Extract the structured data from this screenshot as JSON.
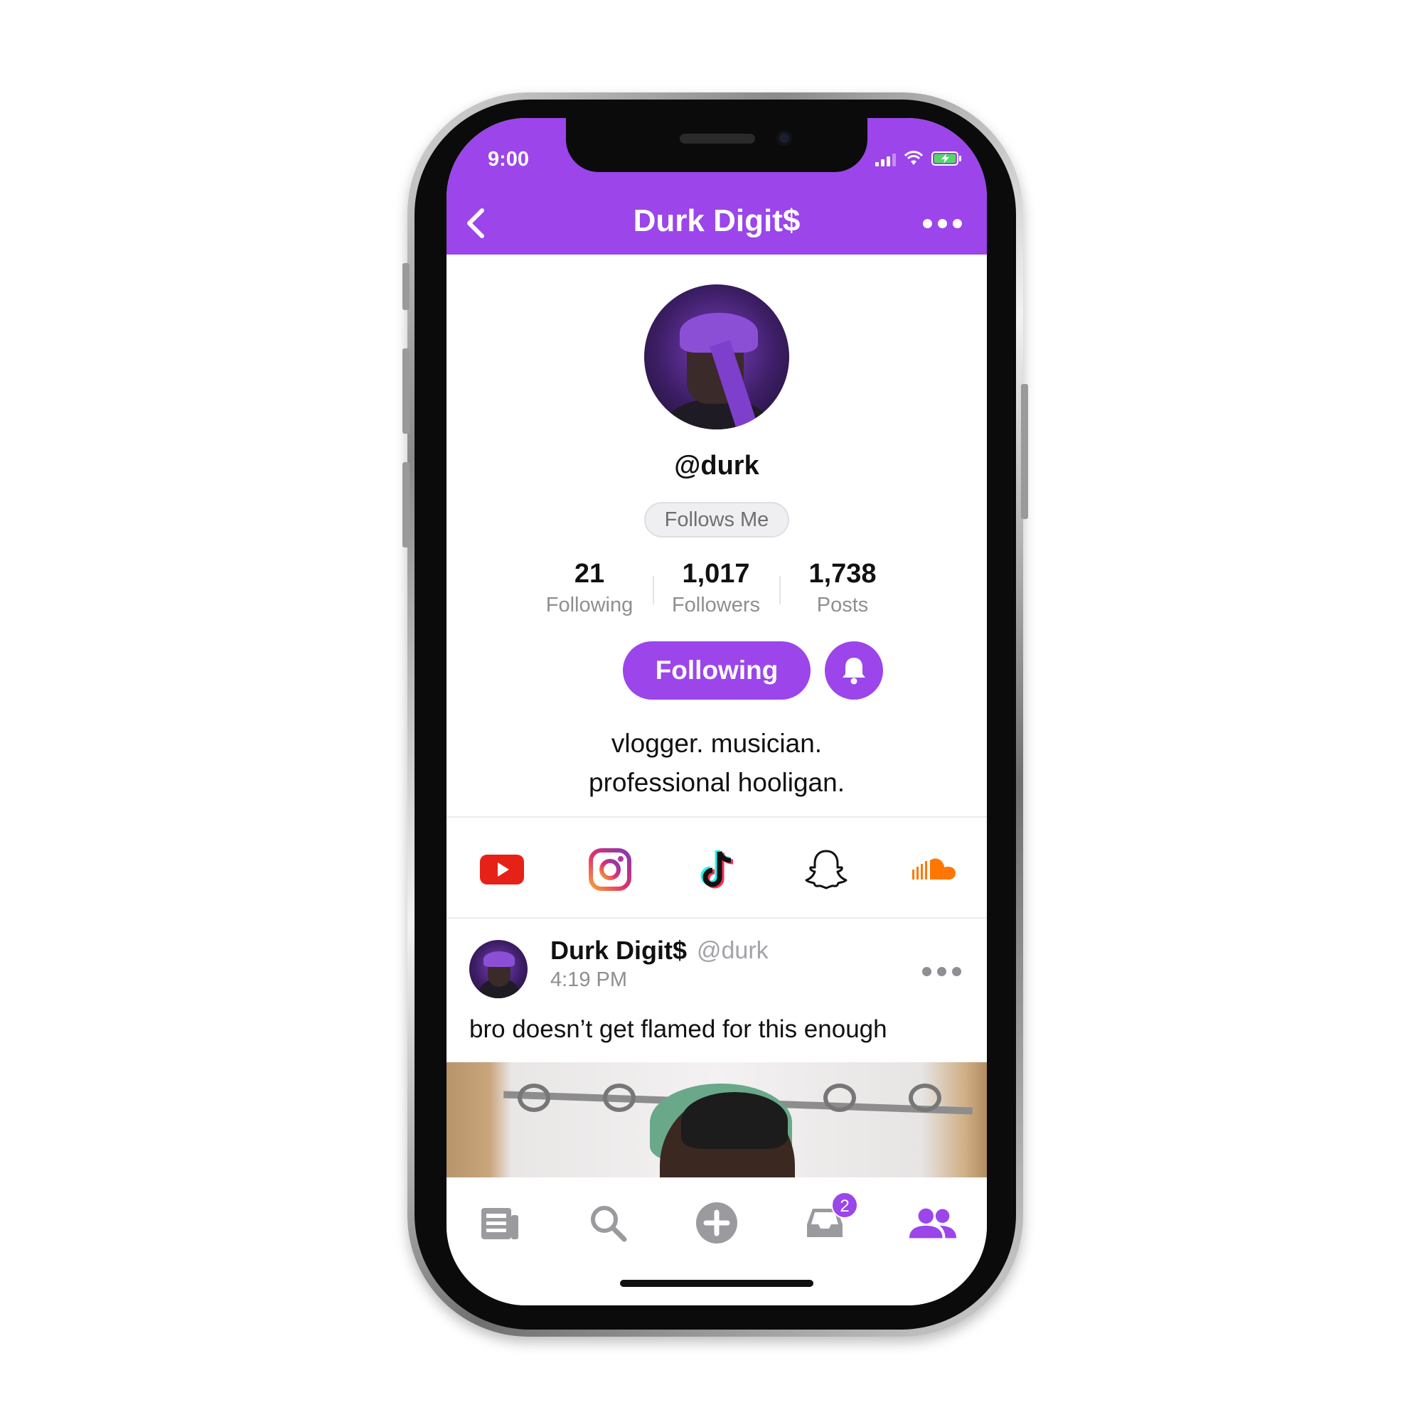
{
  "status_bar": {
    "time": "9:00"
  },
  "header": {
    "title": "Durk Digit$"
  },
  "profile": {
    "handle": "@durk",
    "follows_me_badge": "Follows Me",
    "stats": [
      {
        "value": "21",
        "label": "Following"
      },
      {
        "value": "1,017",
        "label": "Followers"
      },
      {
        "value": "1,738",
        "label": "Posts"
      }
    ],
    "follow_button_label": "Following",
    "bio_line1": "vlogger. musician.",
    "bio_line2": "professional hooligan."
  },
  "social_links": [
    "youtube-icon",
    "instagram-icon",
    "tiktok-icon",
    "snapchat-icon",
    "soundcloud-icon"
  ],
  "post": {
    "author_name": "Durk Digit$",
    "author_handle": "@durk",
    "time": "4:19 PM",
    "text": "bro doesn’t get flamed for this enough"
  },
  "tabbar": {
    "tabs": [
      "news-icon",
      "search-icon",
      "add-icon",
      "inbox-icon",
      "people-icon"
    ],
    "inbox_badge": "2",
    "active_tab": "people-icon"
  },
  "colors": {
    "accent": "#9b45ea",
    "youtube": "#e62117",
    "soundcloud": "#ff7700"
  }
}
